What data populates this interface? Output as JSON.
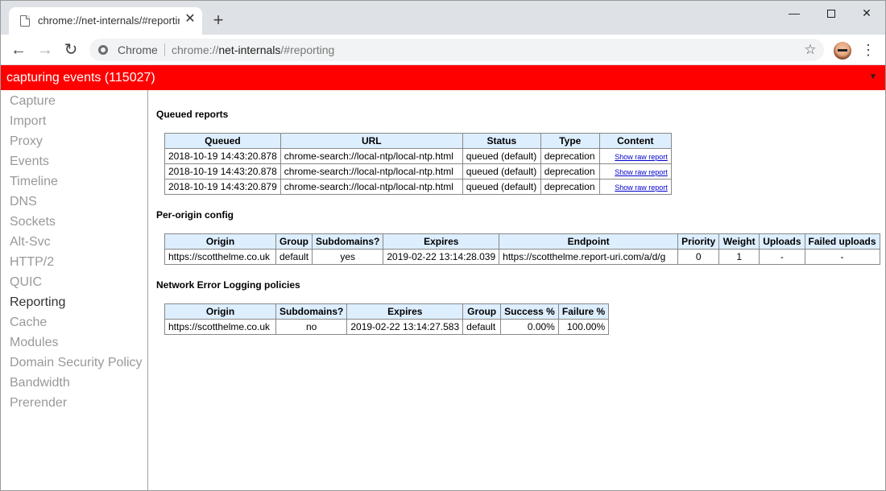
{
  "tab": {
    "title": "chrome://net-internals/#reporting"
  },
  "omnibox": {
    "label": "Chrome",
    "scheme": "chrome://",
    "host": "net-internals",
    "path": "/#reporting"
  },
  "banner": {
    "text": "capturing events (115027)"
  },
  "sidebar": {
    "items": [
      {
        "label": "Capture",
        "active": false
      },
      {
        "label": "Import",
        "active": false
      },
      {
        "label": "Proxy",
        "active": false
      },
      {
        "label": "Events",
        "active": false
      },
      {
        "label": "Timeline",
        "active": false
      },
      {
        "label": "DNS",
        "active": false
      },
      {
        "label": "Sockets",
        "active": false
      },
      {
        "label": "Alt-Svc",
        "active": false
      },
      {
        "label": "HTTP/2",
        "active": false
      },
      {
        "label": "QUIC",
        "active": false
      },
      {
        "label": "Reporting",
        "active": true
      },
      {
        "label": "Cache",
        "active": false
      },
      {
        "label": "Modules",
        "active": false
      },
      {
        "label": "Domain Security Policy",
        "active": false
      },
      {
        "label": "Bandwidth",
        "active": false
      },
      {
        "label": "Prerender",
        "active": false
      }
    ]
  },
  "queued": {
    "heading": "Queued reports",
    "columns": [
      "Queued",
      "URL",
      "Status",
      "Type",
      "Content"
    ],
    "rows": [
      [
        "2018-10-19 14:43:20.878",
        "chrome-search://local-ntp/local-ntp.html",
        "queued (default)",
        "deprecation",
        "Show raw report"
      ],
      [
        "2018-10-19 14:43:20.878",
        "chrome-search://local-ntp/local-ntp.html",
        "queued (default)",
        "deprecation",
        "Show raw report"
      ],
      [
        "2018-10-19 14:43:20.879",
        "chrome-search://local-ntp/local-ntp.html",
        "queued (default)",
        "deprecation",
        "Show raw report"
      ]
    ]
  },
  "origin_config": {
    "heading": "Per-origin config",
    "columns": [
      "Origin",
      "Group",
      "Subdomains?",
      "Expires",
      "Endpoint",
      "Priority",
      "Weight",
      "Uploads",
      "Failed uploads"
    ],
    "rows": [
      [
        "https://scotthelme.co.uk",
        "default",
        "yes",
        "2019-02-22 13:14:28.039",
        "https://scotthelme.report-uri.com/a/d/g",
        "0",
        "1",
        "-",
        "-"
      ]
    ]
  },
  "nel": {
    "heading": "Network Error Logging policies",
    "columns": [
      "Origin",
      "Subdomains?",
      "Expires",
      "Group",
      "Success %",
      "Failure %"
    ],
    "rows": [
      [
        "https://scotthelme.co.uk",
        "no",
        "2019-02-22 13:14:27.583",
        "default",
        "0.00%",
        "100.00%"
      ]
    ]
  }
}
